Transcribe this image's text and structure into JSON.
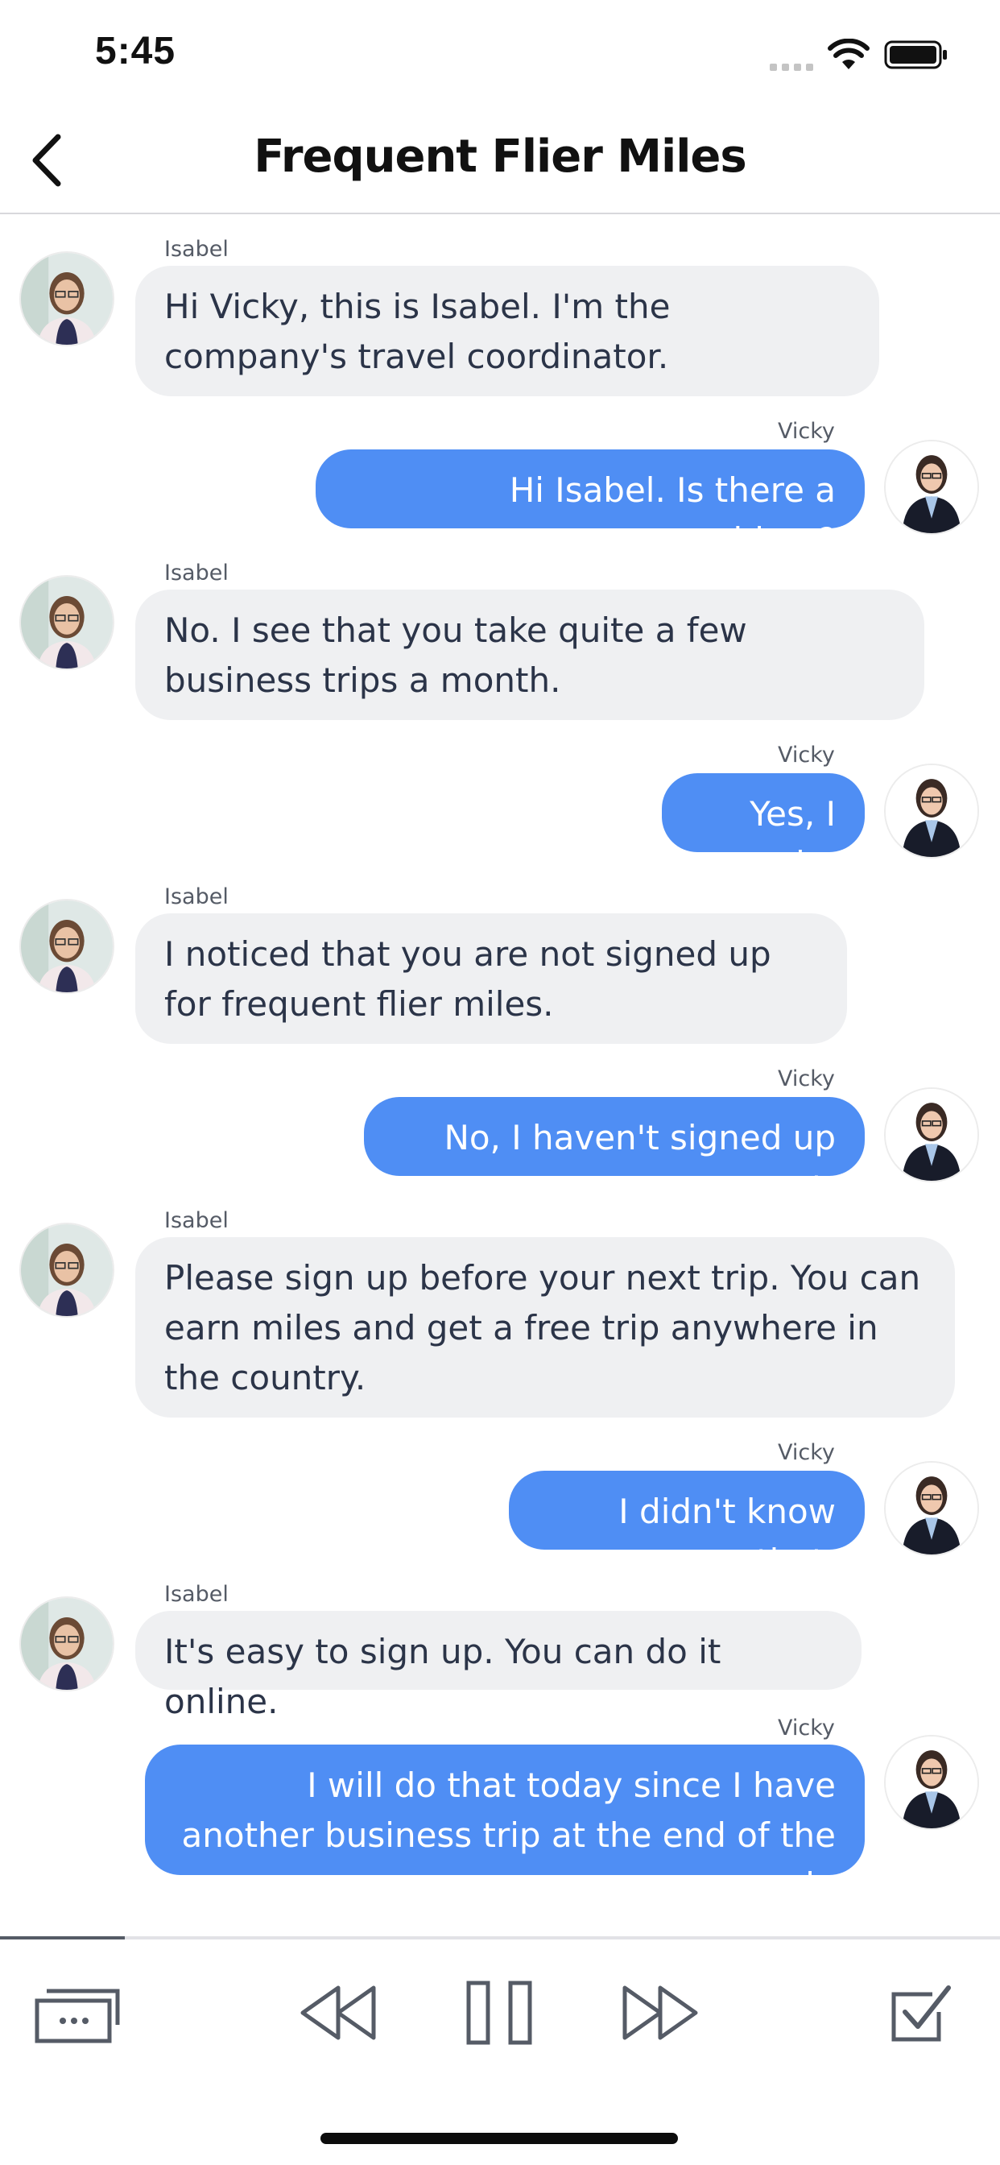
{
  "status_bar": {
    "time": "5:45"
  },
  "nav": {
    "title": "Frequent Flier Miles",
    "back_icon": "chevron-left-icon"
  },
  "messages": [
    {
      "sender": "Isabel",
      "side": "left",
      "text": "Hi Vicky, this is Isabel.  I'm the company's travel coordinator."
    },
    {
      "sender": "Vicky",
      "side": "right",
      "text": "Hi Isabel.  Is there a problem?"
    },
    {
      "sender": "Isabel",
      "side": "left",
      "text": "No.  I see that you take quite a few business trips a month."
    },
    {
      "sender": "Vicky",
      "side": "right",
      "text": "Yes, I do."
    },
    {
      "sender": "Isabel",
      "side": "left",
      "text": "I noticed that you are not signed up for frequent flier miles."
    },
    {
      "sender": "Vicky",
      "side": "right",
      "text": "No, I haven't signed up yet."
    },
    {
      "sender": "Isabel",
      "side": "left",
      "text": "Please sign up before your next trip.  You can earn miles and get a free trip anywhere in the country."
    },
    {
      "sender": "Vicky",
      "side": "right",
      "text": "I didn't know that."
    },
    {
      "sender": "Isabel",
      "side": "left",
      "text": "It's easy to sign up.  You can do it online."
    },
    {
      "sender": "Vicky",
      "side": "right",
      "text": "I will do that today since I have another business trip at the end of the week."
    }
  ],
  "playback": {
    "progress": 0.125
  },
  "toolbar": {
    "icons": [
      "subtitles-icon",
      "rewind-icon",
      "pause-icon",
      "fast-forward-icon",
      "checkbox-icon"
    ]
  },
  "colors": {
    "incoming_bubble": "#eff0f2",
    "outgoing_bubble": "#4f8ef4",
    "outgoing_text": "#ffffff",
    "incoming_text": "#2b3448"
  }
}
